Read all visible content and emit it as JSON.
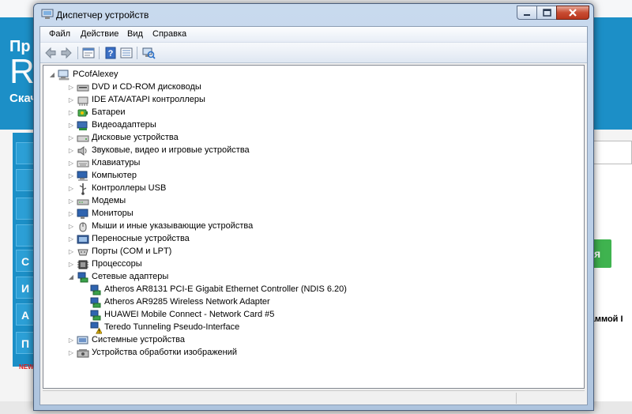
{
  "background": {
    "title_line1": "Пр",
    "title_line2": "R",
    "title_line3": "Скач",
    "tiles": [
      "",
      "",
      "",
      "",
      "С",
      "И",
      "А",
      "П"
    ],
    "news_badge": "NEW",
    "green_button": "я",
    "right_text": "раммой I",
    "colors": {
      "blue": "#1c8fc7",
      "green": "#3fb34f"
    }
  },
  "window": {
    "title": "Диспетчер устройств",
    "icon": "device-manager-icon",
    "buttons": {
      "minimize": "minimize-icon",
      "maximize": "maximize-icon",
      "close": "close-icon"
    }
  },
  "menu": [
    "Файл",
    "Действие",
    "Вид",
    "Справка"
  ],
  "toolbar": [
    "back-arrow-icon",
    "forward-arrow-icon",
    "properties-icon",
    "help-icon",
    "device-list-icon",
    "scan-hardware-icon"
  ],
  "tree": {
    "root": {
      "label": "PCofAlexey",
      "icon": "computer-icon",
      "expanded": true
    },
    "items": [
      {
        "label": "DVD и CD-ROM дисководы",
        "icon": "dvd-drive-icon",
        "level": 1,
        "expanded": false
      },
      {
        "label": "IDE ATA/ATAPI контроллеры",
        "icon": "ide-controller-icon",
        "level": 1,
        "expanded": false
      },
      {
        "label": "Батареи",
        "icon": "battery-icon",
        "level": 1,
        "expanded": false
      },
      {
        "label": "Видеоадаптеры",
        "icon": "display-adapter-icon",
        "level": 1,
        "expanded": false
      },
      {
        "label": "Дисковые устройства",
        "icon": "disk-drive-icon",
        "level": 1,
        "expanded": false
      },
      {
        "label": "Звуковые, видео и игровые устройства",
        "icon": "sound-icon",
        "level": 1,
        "expanded": false
      },
      {
        "label": "Клавиатуры",
        "icon": "keyboard-icon",
        "level": 1,
        "expanded": false
      },
      {
        "label": "Компьютер",
        "icon": "computer-icon",
        "level": 1,
        "expanded": false
      },
      {
        "label": "Контроллеры USB",
        "icon": "usb-icon",
        "level": 1,
        "expanded": false
      },
      {
        "label": "Модемы",
        "icon": "modem-icon",
        "level": 1,
        "expanded": false
      },
      {
        "label": "Мониторы",
        "icon": "monitor-icon",
        "level": 1,
        "expanded": false
      },
      {
        "label": "Мыши и иные указывающие устройства",
        "icon": "mouse-icon",
        "level": 1,
        "expanded": false
      },
      {
        "label": "Переносные устройства",
        "icon": "portable-device-icon",
        "level": 1,
        "expanded": false
      },
      {
        "label": "Порты (COM и LPT)",
        "icon": "port-icon",
        "level": 1,
        "expanded": false
      },
      {
        "label": "Процессоры",
        "icon": "processor-icon",
        "level": 1,
        "expanded": false
      },
      {
        "label": "Сетевые адаптеры",
        "icon": "network-adapter-icon",
        "level": 1,
        "expanded": true
      },
      {
        "label": "Atheros AR8131 PCI-E Gigabit Ethernet Controller (NDIS 6.20)",
        "icon": "network-adapter-icon",
        "level": 2
      },
      {
        "label": "Atheros AR9285 Wireless Network Adapter",
        "icon": "network-adapter-icon",
        "level": 2
      },
      {
        "label": "HUAWEI Mobile Connect - Network Card #5",
        "icon": "network-adapter-icon",
        "level": 2
      },
      {
        "label": "Teredo Tunneling Pseudo-Interface",
        "icon": "network-adapter-warning-icon",
        "level": 2,
        "warning": true
      },
      {
        "label": "Системные устройства",
        "icon": "system-device-icon",
        "level": 1,
        "expanded": false
      },
      {
        "label": "Устройства обработки изображений",
        "icon": "imaging-device-icon",
        "level": 1,
        "expanded": false
      }
    ]
  },
  "status": ""
}
